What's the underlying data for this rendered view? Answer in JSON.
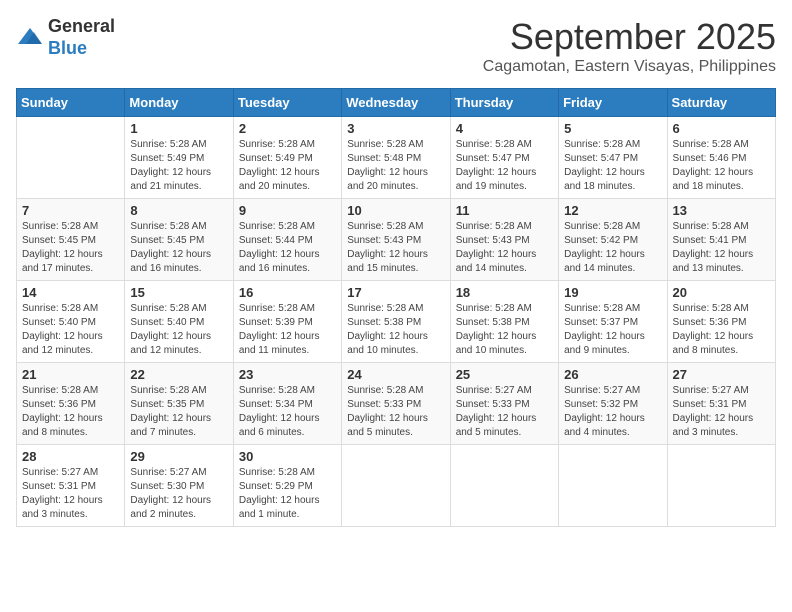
{
  "logo": {
    "general": "General",
    "blue": "Blue"
  },
  "title": "September 2025",
  "location": "Cagamotan, Eastern Visayas, Philippines",
  "days_of_week": [
    "Sunday",
    "Monday",
    "Tuesday",
    "Wednesday",
    "Thursday",
    "Friday",
    "Saturday"
  ],
  "weeks": [
    [
      {
        "day": "",
        "info": ""
      },
      {
        "day": "1",
        "info": "Sunrise: 5:28 AM\nSunset: 5:49 PM\nDaylight: 12 hours\nand 21 minutes."
      },
      {
        "day": "2",
        "info": "Sunrise: 5:28 AM\nSunset: 5:49 PM\nDaylight: 12 hours\nand 20 minutes."
      },
      {
        "day": "3",
        "info": "Sunrise: 5:28 AM\nSunset: 5:48 PM\nDaylight: 12 hours\nand 20 minutes."
      },
      {
        "day": "4",
        "info": "Sunrise: 5:28 AM\nSunset: 5:47 PM\nDaylight: 12 hours\nand 19 minutes."
      },
      {
        "day": "5",
        "info": "Sunrise: 5:28 AM\nSunset: 5:47 PM\nDaylight: 12 hours\nand 18 minutes."
      },
      {
        "day": "6",
        "info": "Sunrise: 5:28 AM\nSunset: 5:46 PM\nDaylight: 12 hours\nand 18 minutes."
      }
    ],
    [
      {
        "day": "7",
        "info": "Sunrise: 5:28 AM\nSunset: 5:45 PM\nDaylight: 12 hours\nand 17 minutes."
      },
      {
        "day": "8",
        "info": "Sunrise: 5:28 AM\nSunset: 5:45 PM\nDaylight: 12 hours\nand 16 minutes."
      },
      {
        "day": "9",
        "info": "Sunrise: 5:28 AM\nSunset: 5:44 PM\nDaylight: 12 hours\nand 16 minutes."
      },
      {
        "day": "10",
        "info": "Sunrise: 5:28 AM\nSunset: 5:43 PM\nDaylight: 12 hours\nand 15 minutes."
      },
      {
        "day": "11",
        "info": "Sunrise: 5:28 AM\nSunset: 5:43 PM\nDaylight: 12 hours\nand 14 minutes."
      },
      {
        "day": "12",
        "info": "Sunrise: 5:28 AM\nSunset: 5:42 PM\nDaylight: 12 hours\nand 14 minutes."
      },
      {
        "day": "13",
        "info": "Sunrise: 5:28 AM\nSunset: 5:41 PM\nDaylight: 12 hours\nand 13 minutes."
      }
    ],
    [
      {
        "day": "14",
        "info": "Sunrise: 5:28 AM\nSunset: 5:40 PM\nDaylight: 12 hours\nand 12 minutes."
      },
      {
        "day": "15",
        "info": "Sunrise: 5:28 AM\nSunset: 5:40 PM\nDaylight: 12 hours\nand 12 minutes."
      },
      {
        "day": "16",
        "info": "Sunrise: 5:28 AM\nSunset: 5:39 PM\nDaylight: 12 hours\nand 11 minutes."
      },
      {
        "day": "17",
        "info": "Sunrise: 5:28 AM\nSunset: 5:38 PM\nDaylight: 12 hours\nand 10 minutes."
      },
      {
        "day": "18",
        "info": "Sunrise: 5:28 AM\nSunset: 5:38 PM\nDaylight: 12 hours\nand 10 minutes."
      },
      {
        "day": "19",
        "info": "Sunrise: 5:28 AM\nSunset: 5:37 PM\nDaylight: 12 hours\nand 9 minutes."
      },
      {
        "day": "20",
        "info": "Sunrise: 5:28 AM\nSunset: 5:36 PM\nDaylight: 12 hours\nand 8 minutes."
      }
    ],
    [
      {
        "day": "21",
        "info": "Sunrise: 5:28 AM\nSunset: 5:36 PM\nDaylight: 12 hours\nand 8 minutes."
      },
      {
        "day": "22",
        "info": "Sunrise: 5:28 AM\nSunset: 5:35 PM\nDaylight: 12 hours\nand 7 minutes."
      },
      {
        "day": "23",
        "info": "Sunrise: 5:28 AM\nSunset: 5:34 PM\nDaylight: 12 hours\nand 6 minutes."
      },
      {
        "day": "24",
        "info": "Sunrise: 5:28 AM\nSunset: 5:33 PM\nDaylight: 12 hours\nand 5 minutes."
      },
      {
        "day": "25",
        "info": "Sunrise: 5:27 AM\nSunset: 5:33 PM\nDaylight: 12 hours\nand 5 minutes."
      },
      {
        "day": "26",
        "info": "Sunrise: 5:27 AM\nSunset: 5:32 PM\nDaylight: 12 hours\nand 4 minutes."
      },
      {
        "day": "27",
        "info": "Sunrise: 5:27 AM\nSunset: 5:31 PM\nDaylight: 12 hours\nand 3 minutes."
      }
    ],
    [
      {
        "day": "28",
        "info": "Sunrise: 5:27 AM\nSunset: 5:31 PM\nDaylight: 12 hours\nand 3 minutes."
      },
      {
        "day": "29",
        "info": "Sunrise: 5:27 AM\nSunset: 5:30 PM\nDaylight: 12 hours\nand 2 minutes."
      },
      {
        "day": "30",
        "info": "Sunrise: 5:28 AM\nSunset: 5:29 PM\nDaylight: 12 hours\nand 1 minute."
      },
      {
        "day": "",
        "info": ""
      },
      {
        "day": "",
        "info": ""
      },
      {
        "day": "",
        "info": ""
      },
      {
        "day": "",
        "info": ""
      }
    ]
  ]
}
